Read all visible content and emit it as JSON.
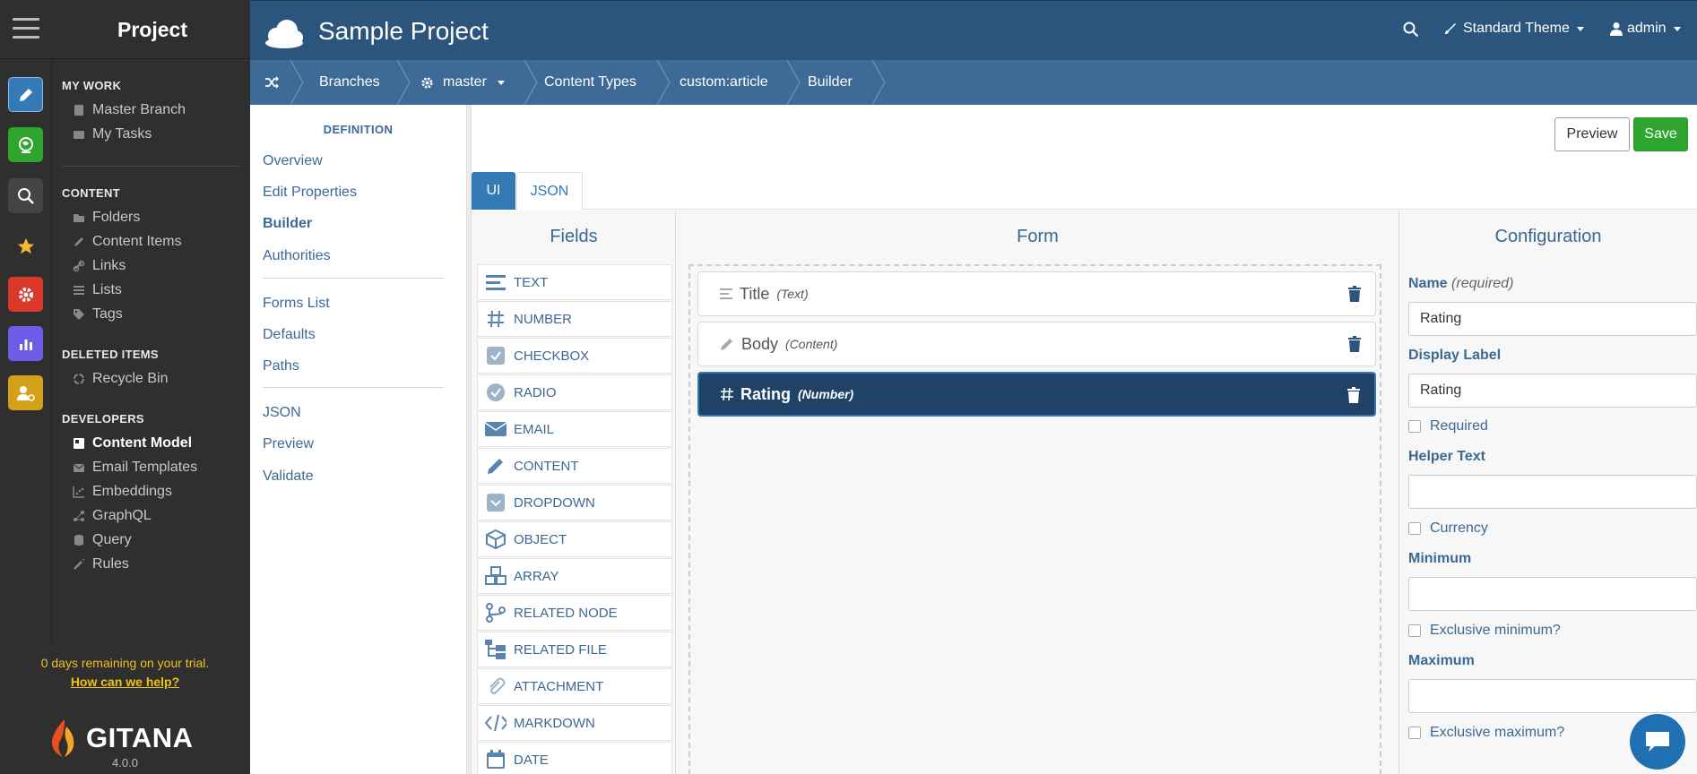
{
  "left": {
    "title": "Project",
    "sections": {
      "mywork": {
        "heading": "MY WORK",
        "items": [
          "Master Branch",
          "My Tasks"
        ]
      },
      "content": {
        "heading": "CONTENT",
        "items": [
          "Folders",
          "Content Items",
          "Links",
          "Lists",
          "Tags"
        ]
      },
      "deleted": {
        "heading": "DELETED ITEMS",
        "items": [
          "Recycle Bin"
        ]
      },
      "developers": {
        "heading": "DEVELOPERS",
        "items": [
          "Content Model",
          "Email Templates",
          "Embeddings",
          "GraphQL",
          "Query",
          "Rules"
        ]
      }
    },
    "trial_text": "0 days remaining on your trial.",
    "help_link": "How can we help?",
    "logo_text": "GITANA",
    "version": "4.0.0",
    "rail_colors": [
      "#337ab7",
      "#2ea62e",
      "#444444",
      "#2f2f2f",
      "#d9382b",
      "#6c5ce7",
      "#d4a017"
    ]
  },
  "header": {
    "app_title": "Sample Project",
    "theme_label": "Standard Theme",
    "user_label": "admin"
  },
  "breadcrumb": [
    "Branches",
    "master",
    "Content Types",
    "custom:article",
    "Builder"
  ],
  "definition": {
    "heading": "DEFINITION",
    "group1": [
      "Overview",
      "Edit Properties",
      "Builder",
      "Authorities"
    ],
    "group2": [
      "Forms List",
      "Defaults",
      "Paths"
    ],
    "group3": [
      "JSON",
      "Preview",
      "Validate"
    ]
  },
  "actions": {
    "preview": "Preview",
    "save": "Save"
  },
  "tabs": {
    "ui": "UI",
    "json": "JSON"
  },
  "fields": {
    "title": "Fields",
    "items": [
      "TEXT",
      "NUMBER",
      "CHECKBOX",
      "RADIO",
      "EMAIL",
      "CONTENT",
      "DROPDOWN",
      "OBJECT",
      "ARRAY",
      "RELATED NODE",
      "RELATED FILE",
      "ATTACHMENT",
      "MARKDOWN",
      "DATE"
    ]
  },
  "form": {
    "title": "Form",
    "rows": [
      {
        "label": "Title",
        "type": "(Text)"
      },
      {
        "label": "Body",
        "type": "(Content)"
      },
      {
        "label": "Rating",
        "type": "(Number)"
      }
    ]
  },
  "config": {
    "title": "Configuration",
    "name_label": "Name",
    "name_required": "(required)",
    "name_value": "Rating",
    "display_label": "Display Label",
    "display_value": "Rating",
    "required_label": "Required",
    "helper_label": "Helper Text",
    "helper_value": "",
    "currency_label": "Currency",
    "minimum_label": "Minimum",
    "minimum_value": "",
    "excl_min_label": "Exclusive minimum?",
    "maximum_label": "Maximum",
    "maximum_value": "",
    "excl_max_label": "Exclusive maximum?"
  }
}
